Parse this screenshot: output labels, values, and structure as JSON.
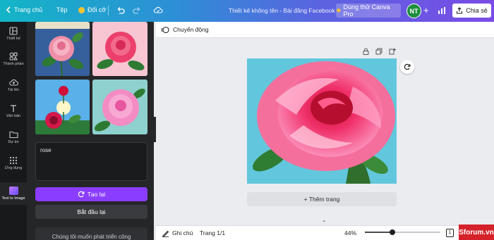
{
  "topbar": {
    "home_label": "Trang chủ",
    "file_label": "Tệp",
    "resize_label": "Đổi cỡ",
    "doc_title": "Thiết kế không tên - Bài đăng Facebook",
    "try_pro_label": "Dùng thử Canva Pro",
    "avatar_initials": "NT",
    "share_label": "Chia sẻ"
  },
  "rail": {
    "items": [
      {
        "label": "Thiết kế",
        "icon": "layout-icon"
      },
      {
        "label": "Thành phần",
        "icon": "elements-icon"
      },
      {
        "label": "Tải lên",
        "icon": "upload-icon"
      },
      {
        "label": "Văn bản",
        "icon": "text-icon"
      },
      {
        "label": "Dự án",
        "icon": "folder-icon"
      },
      {
        "label": "Ứng dụng",
        "icon": "apps-icon"
      },
      {
        "label": "Text to Image",
        "icon": "text-to-image-icon"
      }
    ]
  },
  "panel": {
    "prompt_text": "rose",
    "regenerate_label": "Tạo lại",
    "restart_label": "Bắt đầu lại",
    "feedback_text": "Chúng tôi muốn phát triển công"
  },
  "canvas": {
    "animate_label": "Chuyển động",
    "add_page_label": "+ Thêm trang"
  },
  "bottombar": {
    "notes_label": "Ghi chú",
    "page_label": "Trang 1/1",
    "zoom_label": "44%",
    "page_count": "1",
    "zoom_level": 0.36
  },
  "watermark": {
    "text": "Sforum.vn"
  },
  "colors": {
    "accent": "#8b3dff",
    "panel_bg": "#252627",
    "rail_bg": "#18191b",
    "watermark_red": "#d4222a"
  }
}
